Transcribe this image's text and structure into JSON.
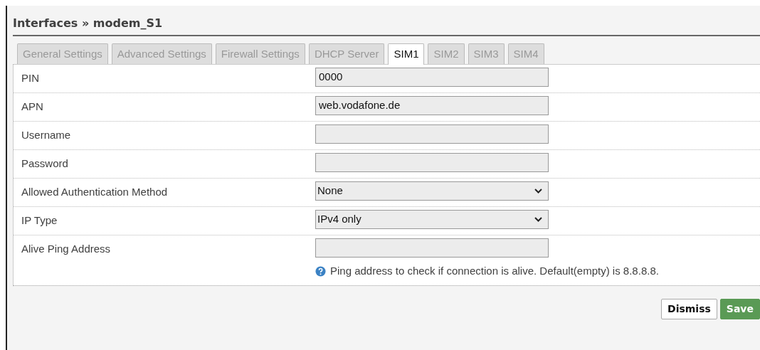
{
  "title": "Interfaces » modem_S1",
  "tabs": [
    {
      "label": "General Settings",
      "selected": false
    },
    {
      "label": "Advanced Settings",
      "selected": false
    },
    {
      "label": "Firewall Settings",
      "selected": false
    },
    {
      "label": "DHCP Server",
      "selected": false
    },
    {
      "label": "SIM1",
      "selected": true
    },
    {
      "label": "SIM2",
      "selected": false
    },
    {
      "label": "SIM3",
      "selected": false
    },
    {
      "label": "SIM4",
      "selected": false
    }
  ],
  "fields": [
    {
      "label": "PIN",
      "kind": "text",
      "value": "0000"
    },
    {
      "label": "APN",
      "kind": "text",
      "value": "web.vodafone.de"
    },
    {
      "label": "Username",
      "kind": "text"
    },
    {
      "label": "Password",
      "kind": "text"
    },
    {
      "label": "Allowed Authentication Method",
      "kind": "select",
      "value": "None"
    },
    {
      "label": "IP Type",
      "kind": "select",
      "value": "IPv4 only"
    },
    {
      "label": "Alive Ping Address",
      "kind": "text",
      "help": "Ping address to check if connection is alive. Default(empty) is 8.8.8.8."
    }
  ],
  "buttons": [
    {
      "label": "Dismiss",
      "kind": "secondary"
    },
    {
      "label": "Save",
      "kind": "primary"
    }
  ]
}
